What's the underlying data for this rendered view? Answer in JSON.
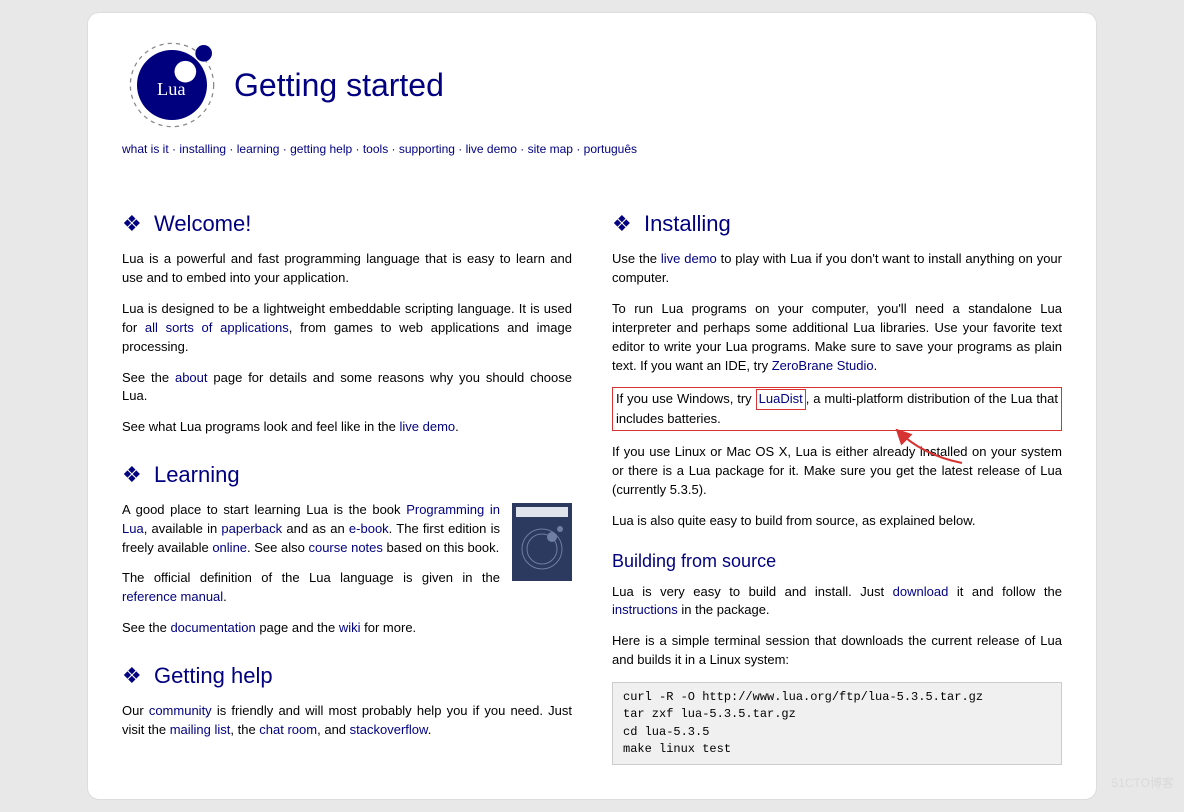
{
  "header": {
    "title": "Getting started",
    "logo_text": "Lua"
  },
  "nav": {
    "items": [
      "what is it",
      "installing",
      "learning",
      "getting help",
      "tools",
      "supporting",
      "live demo",
      "site map",
      "português"
    ]
  },
  "left": {
    "welcome": {
      "heading": "Welcome!",
      "p1_a": "Lua is a powerful and fast programming language that is easy to learn and use and to embed into your application.",
      "p2_a": "Lua is designed to be a lightweight embeddable scripting language. It is used for ",
      "p2_link": "all sorts of applications",
      "p2_b": ", from games to web applications and image processing.",
      "p3_a": "See the ",
      "p3_link": "about",
      "p3_b": " page for details and some reasons why you should choose Lua.",
      "p4_a": "See what Lua programs look and feel like in the ",
      "p4_link": "live demo",
      "p4_b": "."
    },
    "learning": {
      "heading": "Learning",
      "p1_a": "A good place to start learning Lua is the book ",
      "p1_l1": "Programming in Lua",
      "p1_b": ", available in ",
      "p1_l2": "paperback",
      "p1_c": " and as an ",
      "p1_l3": "e-book",
      "p1_d": ". The first edition is freely available ",
      "p1_l4": "online",
      "p1_e": ". See also ",
      "p1_l5": "course notes",
      "p1_f": " based on this book.",
      "p2_a": "The official definition of the Lua language is given in the ",
      "p2_l1": "reference manual",
      "p2_b": ".",
      "p3_a": "See the ",
      "p3_l1": "documentation",
      "p3_b": " page and the ",
      "p3_l2": "wiki",
      "p3_c": " for more."
    },
    "help": {
      "heading": "Getting help",
      "p1_a": "Our ",
      "p1_l1": "community",
      "p1_b": " is friendly and will most probably help you if you need. Just visit the ",
      "p1_l2": "mailing list",
      "p1_c": ", the ",
      "p1_l3": "chat room",
      "p1_d": ", and ",
      "p1_l4": "stackoverflow",
      "p1_e": "."
    }
  },
  "right": {
    "installing": {
      "heading": "Installing",
      "p1_a": "Use the ",
      "p1_l1": "live demo",
      "p1_b": " to play with Lua if you don't want to install anything on your computer.",
      "p2_a": "To run Lua programs on your computer, you'll need a standalone Lua interpreter and perhaps some additional Lua libraries. Use your favorite text editor to write your Lua programs. Make sure to save your programs as plain text. If you want an IDE, try ",
      "p2_l1": "ZeroBrane Studio",
      "p2_b": ".",
      "p3_a": "If you use Windows, try ",
      "p3_l1": "LuaDist",
      "p3_b": ", a multi-platform distribution of the Lua that includes batteries.",
      "p4_a": "If you use Linux or Mac OS X, Lua is either already installed on your system or there is a Lua package for it. Make sure you get the latest release of Lua (currently 5.3.5).",
      "p5_a": "Lua is also quite easy to build from source, as explained below."
    },
    "build": {
      "heading": "Building from source",
      "p1_a": "Lua is very easy to build and install. Just ",
      "p1_l1": "download",
      "p1_b": " it and follow the ",
      "p1_l2": "instructions",
      "p1_c": " in the package.",
      "p2_a": "Here is a simple terminal session that downloads the current release of Lua and builds it in a Linux system:",
      "code": "curl -R -O http://www.lua.org/ftp/lua-5.3.5.tar.gz\ntar zxf lua-5.3.5.tar.gz\ncd lua-5.3.5\nmake linux test"
    }
  },
  "watermark": "51CTO博客"
}
